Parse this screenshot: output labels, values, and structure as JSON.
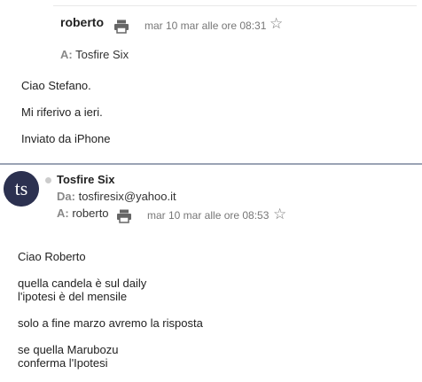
{
  "message1": {
    "sender": "roberto",
    "date": "mar 10 mar alle ore 08:31",
    "to_label": "A:",
    "to": "Tosfire Six",
    "body": [
      "Ciao Stefano.",
      "Mi riferivo a ieri.",
      "Inviato da iPhone"
    ]
  },
  "message2": {
    "avatar_text": "ts",
    "sender": "Tosfire Six",
    "from_label": "Da:",
    "from": "tosfiresix@yahoo.it",
    "to_label": "A:",
    "to": "roberto",
    "date": "mar 10 mar alle ore 08:53",
    "body": [
      "Ciao Roberto",
      "quella candela è sul daily",
      "l'ipotesi è del mensile",
      "solo a fine marzo avremo la risposta",
      "se quella Marubozu",
      "conferma l'Ipotesi"
    ]
  },
  "icons": {
    "print": "print-icon",
    "star": "star-icon"
  }
}
